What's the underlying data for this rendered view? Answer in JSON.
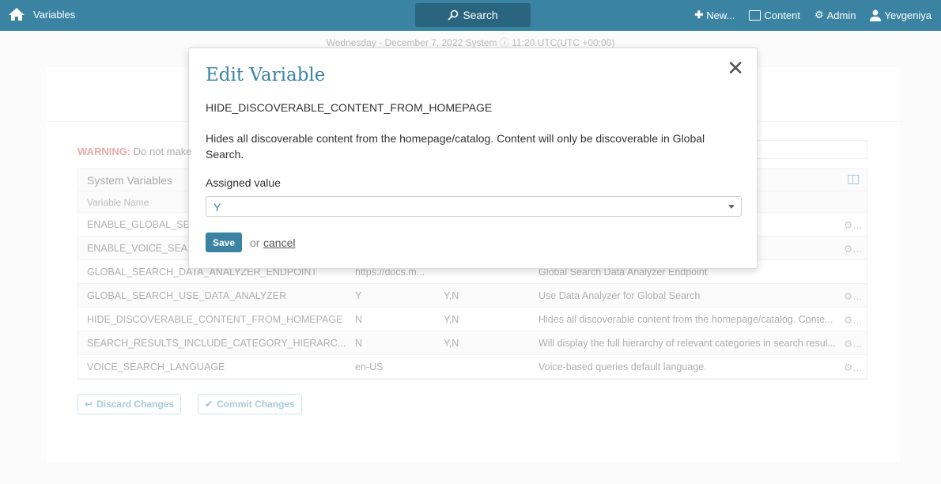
{
  "topbar": {
    "title": "Variables",
    "search": "Search",
    "new": "New...",
    "content": "Content",
    "admin": "Admin",
    "user": "Yevgeniya"
  },
  "dateline": "Wednesday - December 7, 2022 System ⓘ 11:20 UTC(UTC +00:00)",
  "warning": {
    "label": "WARNING:",
    "text": "Do not make"
  },
  "table": {
    "caption": "System Variables",
    "header": "Variable Name",
    "rows": [
      {
        "name": "ENABLE_GLOBAL_SEA",
        "value": "",
        "options": "",
        "desc": "",
        "gear": true
      },
      {
        "name": "ENABLE_VOICE_SEAR",
        "value": "",
        "options": "",
        "desc": "",
        "gear": true
      },
      {
        "name": "GLOBAL_SEARCH_DATA_ANALYZER_ENDPOINT",
        "value": "https://docs.m...",
        "options": "",
        "desc": "Global Search Data Analyzer Endpoint",
        "gear": false
      },
      {
        "name": "GLOBAL_SEARCH_USE_DATA_ANALYZER",
        "value": "Y",
        "options": "Y,N",
        "desc": "Use Data Analyzer for Global Search",
        "gear": true
      },
      {
        "name": "HIDE_DISCOVERABLE_CONTENT_FROM_HOMEPAGE",
        "value": "N",
        "options": "Y,N",
        "desc": "Hides all discoverable content from the homepage/catalog. Conte...",
        "gear": true
      },
      {
        "name": "SEARCH_RESULTS_INCLUDE_CATEGORY_HIERARC...",
        "value": "N",
        "options": "Y,N",
        "desc": "Will display the full hierarchy of relevant categories in search resul...",
        "gear": true
      },
      {
        "name": "VOICE_SEARCH_LANGUAGE",
        "value": "en-US",
        "options": "",
        "desc": "Voice-based queries default language.",
        "gear": true
      }
    ]
  },
  "buttons": {
    "discard": "Discard Changes",
    "commit": "Commit Changes"
  },
  "modal": {
    "title": "Edit Variable",
    "close": "✕",
    "var_name": "HIDE_DISCOVERABLE_CONTENT_FROM_HOMEPAGE",
    "description": "Hides all discoverable content from the homepage/catalog. Content will only be discoverable in Global Search.",
    "field_label": "Assigned value",
    "field_value": "Y",
    "save": "Save",
    "or": "or",
    "cancel": "cancel"
  }
}
